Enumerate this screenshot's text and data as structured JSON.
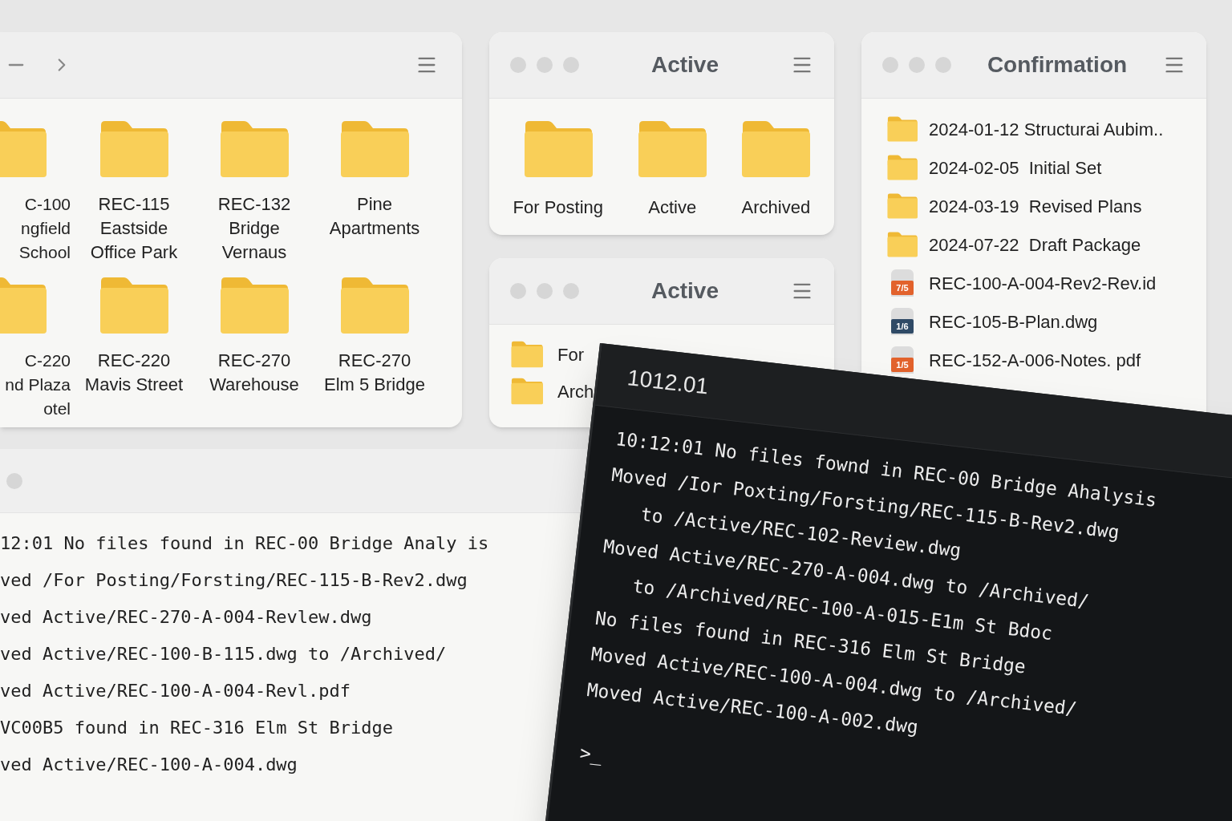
{
  "explorer_window": {
    "folders": [
      {
        "lines": [
          "C-100",
          "ngfield",
          "School"
        ]
      },
      {
        "lines": [
          "REC-115",
          "Eastside",
          "Office Park"
        ]
      },
      {
        "lines": [
          "REC-132",
          "Bridge",
          "Vernaus"
        ]
      },
      {
        "lines": [
          "Pine",
          "Apartments"
        ]
      },
      {
        "lines": [
          "C-220",
          "nd Plaza",
          "otel"
        ]
      },
      {
        "lines": [
          "REC-220",
          "Mavis Street"
        ]
      },
      {
        "lines": [
          "REC-270",
          "Warehouse"
        ]
      },
      {
        "lines": [
          "REC-270",
          "Elm 5 Bridge"
        ]
      }
    ]
  },
  "active_window": {
    "title": "Active",
    "folders": [
      {
        "label": "For Posting"
      },
      {
        "label": "Active"
      },
      {
        "label": "Archived"
      }
    ]
  },
  "active_list_window": {
    "title": "Active",
    "items": [
      {
        "label": "For"
      },
      {
        "label": "Arch"
      }
    ]
  },
  "confirmation_window": {
    "title": "Confirmation",
    "items": [
      {
        "kind": "folder",
        "label": "2024-01-12 Structurai Aubim.."
      },
      {
        "kind": "folder",
        "label": "2024-02-05  Initial Set"
      },
      {
        "kind": "folder",
        "label": "2024-03-19  Revised Plans"
      },
      {
        "kind": "folder",
        "label": "2024-07-22  Draft Package"
      },
      {
        "kind": "file",
        "badge": "7/5",
        "color": "#e2622c",
        "label": "REC-100-A-004-Rev2-Rev.id"
      },
      {
        "kind": "file",
        "badge": "1/6",
        "color": "#2f4a66",
        "label": "REC-105-B-Plan.dwg"
      },
      {
        "kind": "file",
        "badge": "1/5",
        "color": "#e2622c",
        "label": "REC-152-A-006-Notes. pdf"
      }
    ]
  },
  "log_window": {
    "lines": [
      "12:01 No files found in REC-00 Bridge Analy is",
      "ved /For Posting/Forsting/REC-115-B-Rev2.dwg",
      "ved Active/REC-270-A-004-Revlew.dwg",
      "ved Active/REC-100-B-115.dwg to /Archived/",
      "ved Active/REC-100-A-004-Revl.pdf",
      "VC00B5 found in REC-316 Elm St Bridge",
      "ved Active/REC-100-A-004.dwg"
    ]
  },
  "terminal": {
    "title": "1012.01",
    "prompt": ">_",
    "lines": [
      {
        "kind": "line",
        "text": "10:12:01 No files fownd in REC-00 Bridge Ahalysis"
      },
      {
        "kind": "line",
        "text": "Moved /Ior Poxting/Forsting/REC-115-B-Rev2.dwg"
      },
      {
        "kind": "continuation",
        "text": "to /Active/REC-102-Review.dwg"
      },
      {
        "kind": "line",
        "text": "Moved Active/REC-270-A-004.dwg to /Archived/"
      },
      {
        "kind": "continuation",
        "text": "to /Archived/REC-100-A-015-E1m St Bdoc"
      },
      {
        "kind": "line",
        "text": "No files found in REC-316 Elm St Bridge"
      },
      {
        "kind": "line",
        "text": "Moved Active/REC-100-A-004.dwg to /Archived/"
      },
      {
        "kind": "line",
        "text": "Moved Active/REC-100-A-002.dwg"
      }
    ]
  }
}
